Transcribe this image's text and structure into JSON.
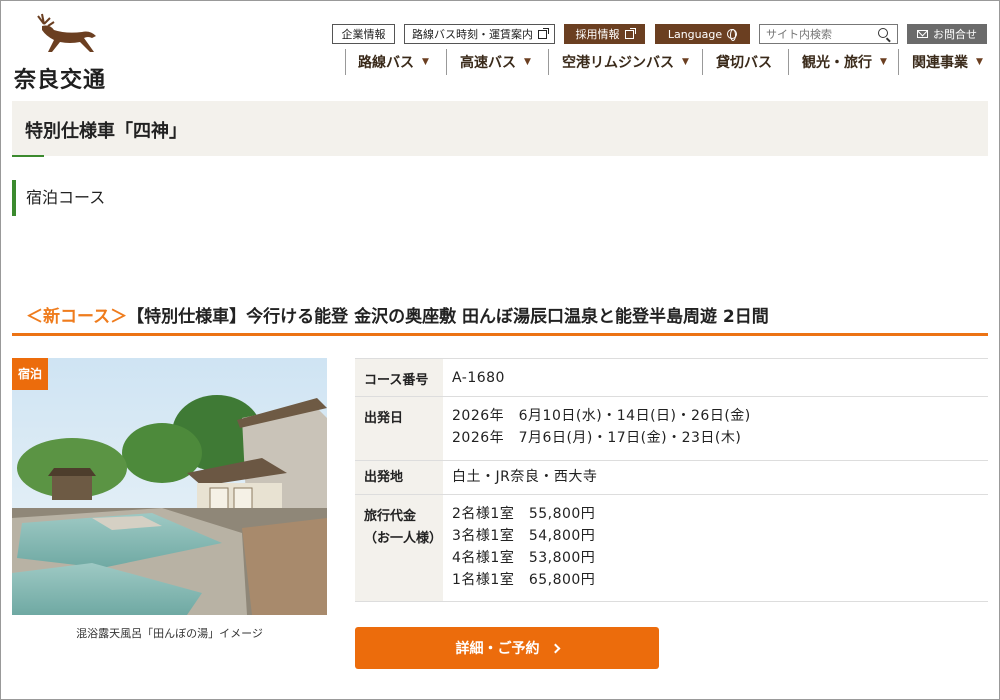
{
  "header": {
    "logo_text": "奈良交通",
    "util_links": {
      "corporate": "企業情報",
      "timetable": "路線バス時刻・運賃案内",
      "recruit": "採用情報",
      "language": "Language",
      "contact": "お問合せ"
    },
    "search": {
      "placeholder": "サイト内検索"
    },
    "nav": {
      "route_bus": "路線バス",
      "highway_bus": "高速バス",
      "airport_limousine": "空港リムジンバス",
      "charter": "貸切バス",
      "tourism": "観光・旅行",
      "related": "関連事業"
    }
  },
  "page": {
    "title": "特別仕様車「四神」",
    "section": "宿泊コース"
  },
  "course": {
    "new_tag": "＜新コース＞",
    "name": "【特別仕様車】今行ける能登 金沢の奥座敷 田んぼ湯辰口温泉と能登半島周遊 2日間",
    "badge": "宿泊",
    "image_caption": "混浴露天風呂「田んぼの湯」イメージ",
    "info": {
      "number_label": "コース番号",
      "number": "A-1680",
      "date_label": "出発日",
      "dates": [
        "2026年　6月10日(水)・14日(日)・26日(金)",
        "2026年　7月6日(月)・17日(金)・23日(木)"
      ],
      "origin_label": "出発地",
      "origin": "白土・JR奈良・西大寺",
      "price_label_1": "旅行代金",
      "price_label_2": "（お一人様）",
      "prices": [
        "2名様1室　55,800円",
        "3名様1室　54,800円",
        "4名様1室　53,800円",
        "1名様1室　65,800円"
      ]
    },
    "button": "詳細・ご予約"
  },
  "colors": {
    "accent_orange": "#ec6c0c",
    "accent_green": "#3b8a2e",
    "brand_brown": "#6b3f21"
  }
}
